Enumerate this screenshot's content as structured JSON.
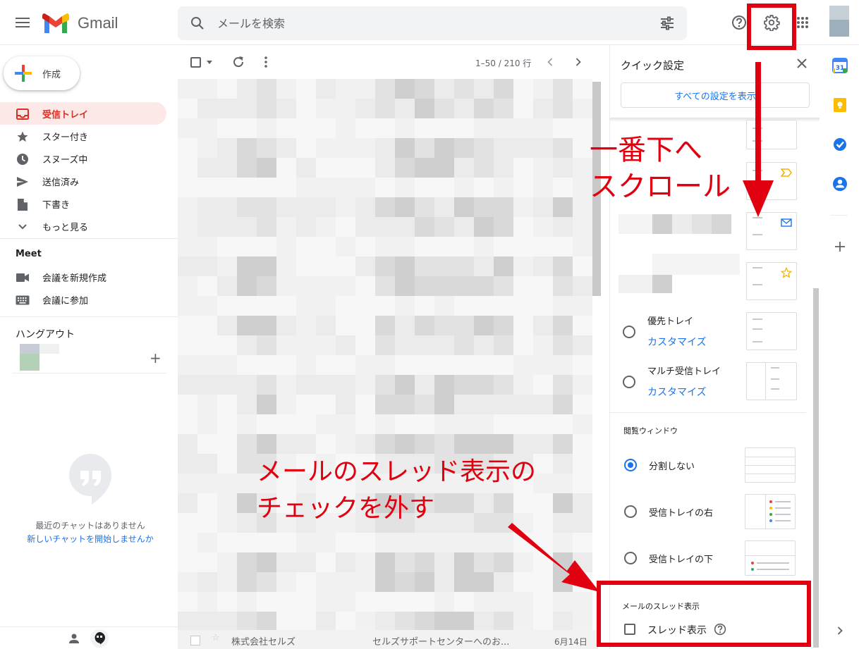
{
  "header": {
    "app_name": "Gmail",
    "search_placeholder": "メールを検索"
  },
  "nav": {
    "compose": "作成",
    "items": [
      {
        "label": "受信トレイ"
      },
      {
        "label": "スター付き"
      },
      {
        "label": "スヌーズ中"
      },
      {
        "label": "送信済み"
      },
      {
        "label": "下書き"
      },
      {
        "label": "もっと見る"
      }
    ],
    "meet_title": "Meet",
    "meet_items": [
      {
        "label": "会議を新規作成"
      },
      {
        "label": "会議に参加"
      }
    ],
    "hangouts_title": "ハングアウト",
    "no_chat": "最近のチャットはありません",
    "start_chat": "新しいチャットを開始しませんか"
  },
  "list": {
    "range": "1–50 / 210 行",
    "last_row": {
      "sender": "株式会社セルズ",
      "subject": "セルズサポートセンターへのお...",
      "date": "6月14日"
    }
  },
  "quick_settings": {
    "title": "クイック設定",
    "all_settings": "すべての設定を表示",
    "priority_inbox": "優先トレイ",
    "customize": "カスタマイズ",
    "multi_inbox": "マルチ受信トレイ",
    "reading_pane_title": "閲覧ウィンドウ",
    "no_split": "分割しない",
    "right_of_inbox": "受信トレイの右",
    "below_inbox": "受信トレイの下",
    "thread_title": "メールのスレッド表示",
    "thread_label": "スレッド表示"
  },
  "annotations": {
    "scroll_line1": "一番下へ",
    "scroll_line2": "スクロール",
    "uncheck_line1": "メールのスレッド表示の",
    "uncheck_line2": "チェックを外す"
  },
  "colors": {
    "accent_red": "#e0000f",
    "gmail_active": "#d93025",
    "link_blue": "#1a73e8"
  }
}
